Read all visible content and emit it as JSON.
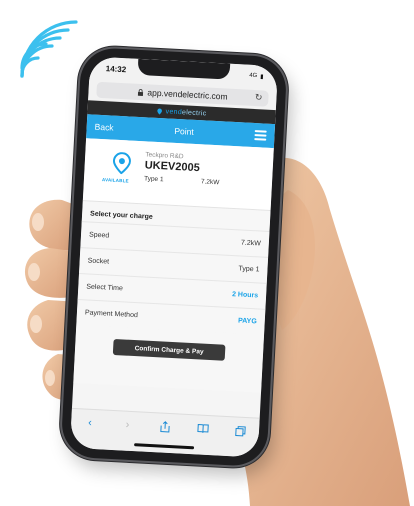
{
  "status": {
    "time": "14:32",
    "signal": "4G"
  },
  "browser": {
    "url": "app.vendelectric.com"
  },
  "brand": {
    "name_part1": "vend",
    "name_part2": "electric"
  },
  "nav": {
    "back_label": "Back",
    "title": "Point"
  },
  "point": {
    "operator": "Teckpro R&D",
    "id": "UKEV2005",
    "status": "AVAILABLE",
    "socket": "Type 1",
    "power": "7.2kW"
  },
  "charge": {
    "section_title": "Select your charge",
    "rows": [
      {
        "label": "Speed",
        "value": "7.2kW"
      },
      {
        "label": "Socket",
        "value": "Type 1"
      },
      {
        "label": "Select Time",
        "value": "2 Hours"
      },
      {
        "label": "Payment Method",
        "value": "PAYG"
      }
    ],
    "confirm_label": "Confirm Charge & Pay"
  },
  "colors": {
    "accent": "#29a8e8",
    "dark": "#2b2b2b",
    "button": "#3a3a3a"
  },
  "icons": [
    "contactless-wifi-icon",
    "lock-icon",
    "reload-icon",
    "map-pin-icon",
    "hamburger-icon",
    "back-arrow-icon",
    "forward-arrow-icon",
    "share-icon",
    "bookmarks-icon",
    "tabs-icon"
  ]
}
